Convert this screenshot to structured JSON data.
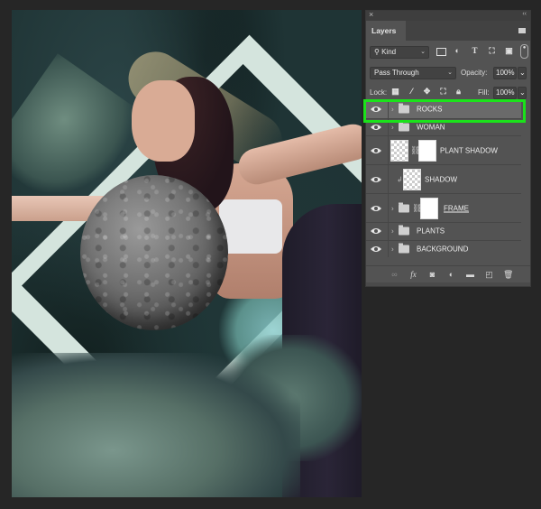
{
  "panel": {
    "title": "Layers",
    "close_icon": "close-icon",
    "collapse_icon": "double-chevron-icon",
    "filter": {
      "kind_label": "Kind",
      "icons": [
        "pixel-filter-icon",
        "adjustment-filter-icon",
        "type-filter-icon",
        "shape-filter-icon",
        "smart-object-filter-icon",
        "filter-toggle-icon"
      ]
    },
    "blend_mode": "Pass Through",
    "opacity_label": "Opacity:",
    "opacity_value": "100%",
    "lock_label": "Lock:",
    "lock_icons": [
      "lock-transparent-icon",
      "lock-image-icon",
      "lock-position-icon",
      "lock-artboard-icon",
      "lock-all-icon"
    ],
    "fill_label": "Fill:",
    "fill_value": "100%",
    "layers": [
      {
        "name": "ROCKS",
        "type": "group",
        "visible": true,
        "selected": true
      },
      {
        "name": "WOMAN",
        "type": "group",
        "visible": true,
        "selected": false
      },
      {
        "name": "PLANT SHADOW",
        "type": "layer-with-mask",
        "visible": true,
        "selected": false
      },
      {
        "name": "SHADOW",
        "type": "clipped-layer",
        "visible": true,
        "selected": false
      },
      {
        "name": "FRAME",
        "type": "group-with-mask",
        "visible": true,
        "selected": false
      },
      {
        "name": "PLANTS",
        "type": "group",
        "visible": true,
        "selected": false
      },
      {
        "name": "BACKGROUND",
        "type": "group",
        "visible": true,
        "selected": false
      }
    ],
    "bottom_icons": [
      "link-layers-icon",
      "fx-icon",
      "add-mask-icon",
      "adjustment-layer-icon",
      "new-group-icon",
      "new-layer-icon",
      "trash-icon"
    ]
  },
  "colors": {
    "highlight": "#1be21b",
    "panel_bg": "#535353",
    "app_bg": "#262626"
  }
}
